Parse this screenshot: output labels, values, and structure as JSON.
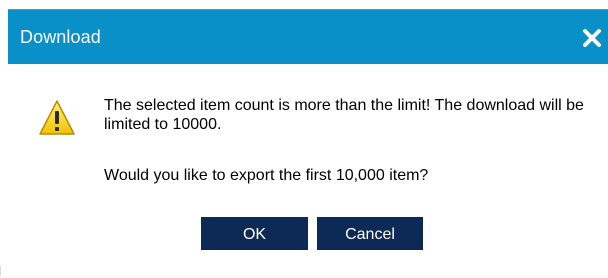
{
  "dialog": {
    "title": "Download",
    "close_icon": "close-icon",
    "warning_icon": "warning-triangle-icon",
    "message": "The selected item count is more than the limit! The download will be limited to 10000.",
    "question": "Would you like to export the first 10,000 item?",
    "ok_label": "OK",
    "cancel_label": "Cancel"
  },
  "colors": {
    "titlebar": "#0a90c8",
    "button": "#0c2a55",
    "warning_fill": "#f7d417",
    "text": "#000000"
  }
}
